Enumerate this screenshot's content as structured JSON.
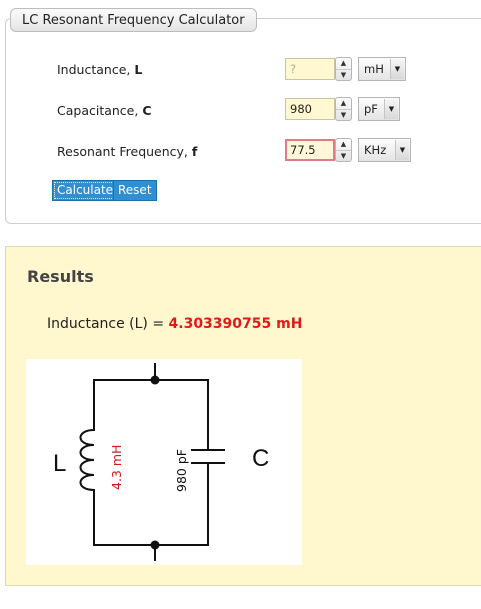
{
  "calculator": {
    "title": "LC Resonant Frequency Calculator",
    "inductance": {
      "label": "Inductance, ",
      "symbol": "L",
      "value": "",
      "placeholder": "?",
      "unit": "mH"
    },
    "capacitance": {
      "label": "Capacitance, ",
      "symbol": "C",
      "value": "980",
      "placeholder": "",
      "unit": "pF"
    },
    "frequency": {
      "label": "Resonant Frequency, ",
      "symbol": "f",
      "value": "77.5",
      "placeholder": "",
      "unit": "KHz"
    },
    "calculate_label": "Calculate",
    "reset_label": "Reset"
  },
  "results": {
    "heading": "Results",
    "line_prefix": "Inductance (L) = ",
    "line_value": "4.303390755 mH",
    "circuit": {
      "inductor_symbol": "L",
      "capacitor_symbol": "C",
      "inductor_value": "4.3 mH",
      "capacitor_value": "980 pF"
    }
  },
  "colors": {
    "accent_button": "#2f8fd0",
    "result_value": "#e0191b",
    "results_background": "#fff7cd",
    "input_background": "#fff8d0",
    "active_input_border": "#e27a8a"
  }
}
